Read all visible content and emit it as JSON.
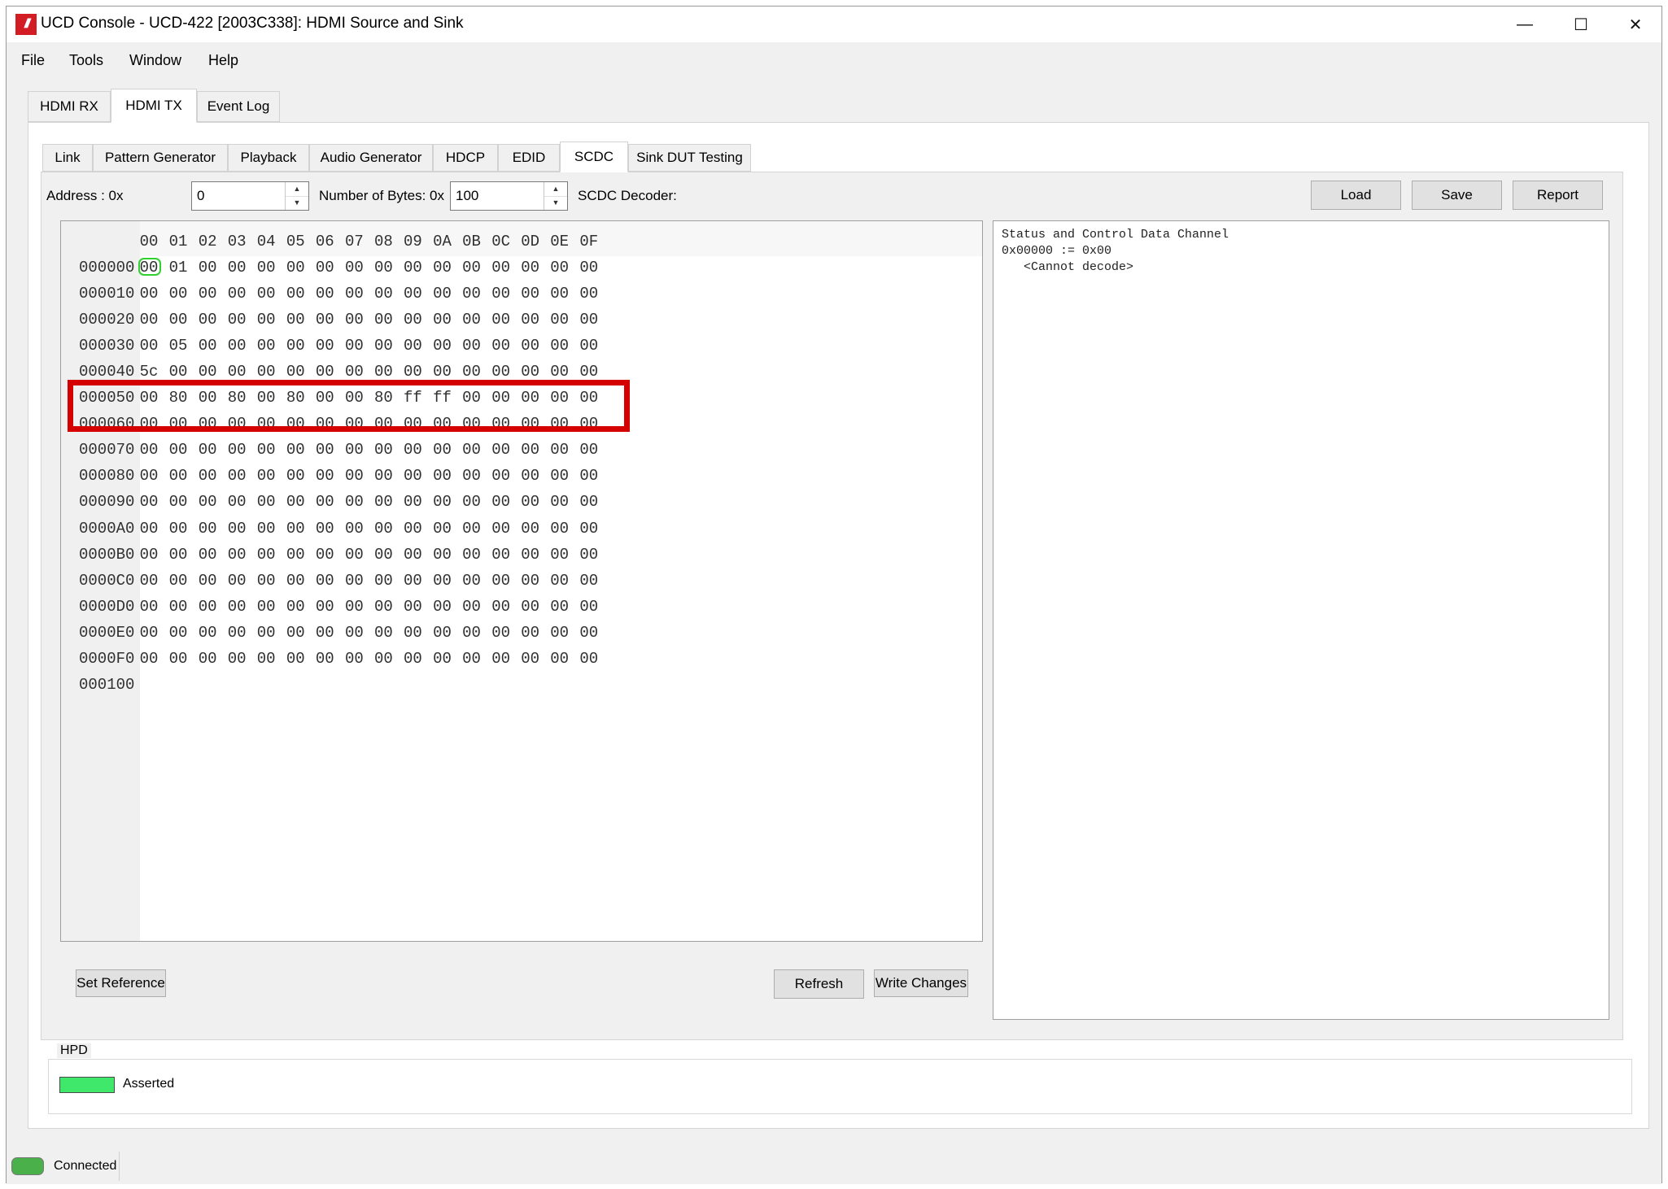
{
  "window": {
    "title": "UCD Console - UCD-422 [2003C338]: HDMI Source and Sink",
    "logo_text": "///",
    "controls": {
      "minimize": "—",
      "maximize": "☐",
      "close": "✕"
    }
  },
  "menu": [
    "File",
    "Tools",
    "Window",
    "Help"
  ],
  "main_tabs": [
    "HDMI RX",
    "HDMI TX",
    "Event Log"
  ],
  "main_tab_active": "HDMI TX",
  "sub_tabs": [
    "Link",
    "Pattern Generator",
    "Playback",
    "Audio Generator",
    "HDCP",
    "EDID",
    "SCDC",
    "Sink DUT Testing"
  ],
  "sub_tab_active": "SCDC",
  "scdc": {
    "address_label": "Address : 0x",
    "address_value": "0",
    "bytes_label": "Number of Bytes: 0x",
    "bytes_value": "100",
    "decoder_label": "SCDC Decoder:",
    "load_label": "Load",
    "save_label": "Save",
    "report_label": "Report",
    "set_reference_label": "Set Reference",
    "refresh_label": "Refresh",
    "write_changes_label": "Write Changes",
    "hex_header": [
      "00",
      "01",
      "02",
      "03",
      "04",
      "05",
      "06",
      "07",
      "08",
      "09",
      "0A",
      "0B",
      "0C",
      "0D",
      "0E",
      "0F"
    ],
    "hex_rows": [
      {
        "addr": "000000",
        "bytes": [
          "00",
          "01",
          "00",
          "00",
          "00",
          "00",
          "00",
          "00",
          "00",
          "00",
          "00",
          "00",
          "00",
          "00",
          "00",
          "00"
        ]
      },
      {
        "addr": "000010",
        "bytes": [
          "00",
          "00",
          "00",
          "00",
          "00",
          "00",
          "00",
          "00",
          "00",
          "00",
          "00",
          "00",
          "00",
          "00",
          "00",
          "00"
        ]
      },
      {
        "addr": "000020",
        "bytes": [
          "00",
          "00",
          "00",
          "00",
          "00",
          "00",
          "00",
          "00",
          "00",
          "00",
          "00",
          "00",
          "00",
          "00",
          "00",
          "00"
        ]
      },
      {
        "addr": "000030",
        "bytes": [
          "00",
          "05",
          "00",
          "00",
          "00",
          "00",
          "00",
          "00",
          "00",
          "00",
          "00",
          "00",
          "00",
          "00",
          "00",
          "00"
        ]
      },
      {
        "addr": "000040",
        "bytes": [
          "5c",
          "00",
          "00",
          "00",
          "00",
          "00",
          "00",
          "00",
          "00",
          "00",
          "00",
          "00",
          "00",
          "00",
          "00",
          "00"
        ]
      },
      {
        "addr": "000050",
        "bytes": [
          "00",
          "80",
          "00",
          "80",
          "00",
          "80",
          "00",
          "00",
          "80",
          "ff",
          "ff",
          "00",
          "00",
          "00",
          "00",
          "00"
        ]
      },
      {
        "addr": "000060",
        "bytes": [
          "00",
          "00",
          "00",
          "00",
          "00",
          "00",
          "00",
          "00",
          "00",
          "00",
          "00",
          "00",
          "00",
          "00",
          "00",
          "00"
        ]
      },
      {
        "addr": "000070",
        "bytes": [
          "00",
          "00",
          "00",
          "00",
          "00",
          "00",
          "00",
          "00",
          "00",
          "00",
          "00",
          "00",
          "00",
          "00",
          "00",
          "00"
        ]
      },
      {
        "addr": "000080",
        "bytes": [
          "00",
          "00",
          "00",
          "00",
          "00",
          "00",
          "00",
          "00",
          "00",
          "00",
          "00",
          "00",
          "00",
          "00",
          "00",
          "00"
        ]
      },
      {
        "addr": "000090",
        "bytes": [
          "00",
          "00",
          "00",
          "00",
          "00",
          "00",
          "00",
          "00",
          "00",
          "00",
          "00",
          "00",
          "00",
          "00",
          "00",
          "00"
        ]
      },
      {
        "addr": "0000A0",
        "bytes": [
          "00",
          "00",
          "00",
          "00",
          "00",
          "00",
          "00",
          "00",
          "00",
          "00",
          "00",
          "00",
          "00",
          "00",
          "00",
          "00"
        ]
      },
      {
        "addr": "0000B0",
        "bytes": [
          "00",
          "00",
          "00",
          "00",
          "00",
          "00",
          "00",
          "00",
          "00",
          "00",
          "00",
          "00",
          "00",
          "00",
          "00",
          "00"
        ]
      },
      {
        "addr": "0000C0",
        "bytes": [
          "00",
          "00",
          "00",
          "00",
          "00",
          "00",
          "00",
          "00",
          "00",
          "00",
          "00",
          "00",
          "00",
          "00",
          "00",
          "00"
        ]
      },
      {
        "addr": "0000D0",
        "bytes": [
          "00",
          "00",
          "00",
          "00",
          "00",
          "00",
          "00",
          "00",
          "00",
          "00",
          "00",
          "00",
          "00",
          "00",
          "00",
          "00"
        ]
      },
      {
        "addr": "0000E0",
        "bytes": [
          "00",
          "00",
          "00",
          "00",
          "00",
          "00",
          "00",
          "00",
          "00",
          "00",
          "00",
          "00",
          "00",
          "00",
          "00",
          "00"
        ]
      },
      {
        "addr": "0000F0",
        "bytes": [
          "00",
          "00",
          "00",
          "00",
          "00",
          "00",
          "00",
          "00",
          "00",
          "00",
          "00",
          "00",
          "00",
          "00",
          "00",
          "00"
        ]
      },
      {
        "addr": "000100",
        "bytes": []
      }
    ],
    "decoder_lines": [
      "Status and Control Data Channel",
      "0x00000 := 0x00",
      "   <Cannot decode>"
    ],
    "highlighted_row": "000050",
    "selected_byte": {
      "row": "000000",
      "col": "00"
    }
  },
  "hpd": {
    "group_label": "HPD",
    "status_text": "Asserted",
    "indicator_color": "#3fe86a"
  },
  "status": {
    "connection_text": "Connected",
    "indicator_color": "#4ab04a"
  },
  "colors": {
    "highlight": "#d50000",
    "cursor": "#2fd12f",
    "logo": "#d31d25"
  }
}
